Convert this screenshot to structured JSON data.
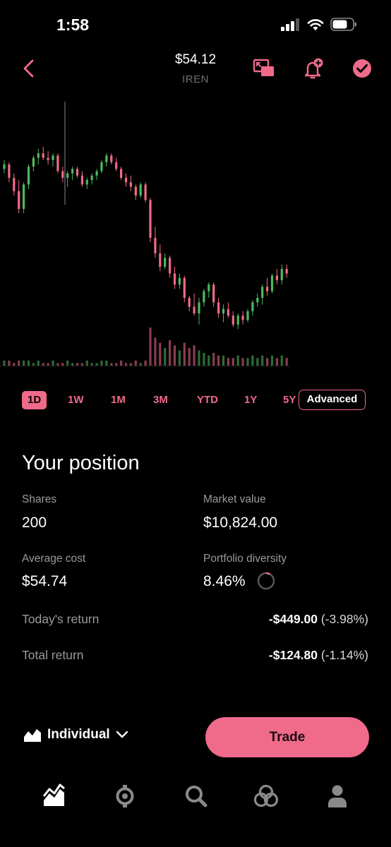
{
  "status_bar": {
    "time": "1:58"
  },
  "header": {
    "price": "$54.12",
    "symbol": "IREN",
    "accent_color": "#f06a8a"
  },
  "chart_data": {
    "type": "candlestick",
    "up_color": "#4cbb5a",
    "down_color": "#f06a8a",
    "ylim": [
      0,
      100
    ],
    "candles": [
      [
        78,
        82,
        76,
        80
      ],
      [
        80,
        81,
        72,
        74
      ],
      [
        74,
        76,
        66,
        68
      ],
      [
        68,
        73,
        58,
        60
      ],
      [
        60,
        72,
        58,
        71
      ],
      [
        71,
        80,
        69,
        79
      ],
      [
        79,
        84,
        77,
        83
      ],
      [
        83,
        87,
        80,
        85
      ],
      [
        85,
        88,
        82,
        83
      ],
      [
        83,
        86,
        80,
        82
      ],
      [
        82,
        85,
        79,
        84
      ],
      [
        84,
        85,
        76,
        77
      ],
      [
        77,
        79,
        72,
        74
      ],
      [
        74,
        77,
        70,
        76
      ],
      [
        76,
        79,
        73,
        78
      ],
      [
        78,
        79,
        74,
        75
      ],
      [
        75,
        77,
        70,
        71
      ],
      [
        71,
        74,
        69,
        73
      ],
      [
        73,
        76,
        71,
        75
      ],
      [
        75,
        78,
        73,
        77
      ],
      [
        77,
        82,
        76,
        81
      ],
      [
        81,
        85,
        79,
        84
      ],
      [
        84,
        85,
        80,
        81
      ],
      [
        81,
        83,
        77,
        78
      ],
      [
        78,
        79,
        73,
        74
      ],
      [
        74,
        76,
        70,
        72
      ],
      [
        72,
        75,
        68,
        70
      ],
      [
        70,
        71,
        64,
        66
      ],
      [
        66,
        72,
        65,
        71
      ],
      [
        71,
        72,
        63,
        64
      ],
      [
        64,
        65,
        45,
        47
      ],
      [
        47,
        52,
        38,
        40
      ],
      [
        40,
        44,
        32,
        34
      ],
      [
        34,
        40,
        33,
        38
      ],
      [
        38,
        39,
        29,
        31
      ],
      [
        31,
        34,
        24,
        26
      ],
      [
        26,
        31,
        24,
        29
      ],
      [
        29,
        30,
        18,
        20
      ],
      [
        20,
        21,
        14,
        16
      ],
      [
        16,
        22,
        12,
        13
      ],
      [
        13,
        20,
        8,
        18
      ],
      [
        18,
        24,
        16,
        23
      ],
      [
        23,
        27,
        20,
        26
      ],
      [
        26,
        27,
        16,
        18
      ],
      [
        18,
        20,
        11,
        13
      ],
      [
        13,
        17,
        9,
        15
      ],
      [
        15,
        18,
        11,
        12
      ],
      [
        12,
        14,
        7,
        8
      ],
      [
        8,
        13,
        6,
        12
      ],
      [
        12,
        14,
        8,
        10
      ],
      [
        10,
        15,
        9,
        14
      ],
      [
        14,
        19,
        12,
        18
      ],
      [
        18,
        22,
        16,
        20
      ],
      [
        20,
        26,
        17,
        25
      ],
      [
        25,
        29,
        21,
        23
      ],
      [
        23,
        31,
        22,
        30
      ],
      [
        30,
        33,
        26,
        28
      ],
      [
        28,
        35,
        26,
        33
      ],
      [
        33,
        35,
        29,
        31
      ]
    ],
    "volumes": [
      2,
      2,
      1,
      2,
      2,
      2,
      1,
      2,
      1,
      1,
      2,
      1,
      1,
      2,
      1,
      1,
      1,
      2,
      1,
      1,
      2,
      2,
      1,
      1,
      2,
      1,
      1,
      2,
      1,
      2,
      15,
      11,
      9,
      7,
      10,
      8,
      6,
      9,
      7,
      8,
      6,
      5,
      4,
      5,
      4,
      4,
      3,
      3,
      4,
      3,
      3,
      4,
      3,
      4,
      3,
      4,
      3,
      4,
      3
    ]
  },
  "ranges": {
    "tabs": [
      "1D",
      "1W",
      "1M",
      "3M",
      "YTD",
      "1Y",
      "5Y"
    ],
    "active": "1D",
    "advanced_label": "Advanced"
  },
  "position": {
    "title": "Your position",
    "shares_label": "Shares",
    "shares_value": "200",
    "market_value_label": "Market value",
    "market_value": "$10,824.00",
    "avg_cost_label": "Average cost",
    "avg_cost_value": "$54.74",
    "diversity_label": "Portfolio diversity",
    "diversity_value": "8.46%",
    "diversity_fraction": 0.0846,
    "todays_return_label": "Today's return",
    "todays_return_amount": "-$449.00",
    "todays_return_pct": "(-3.98%)",
    "total_return_label": "Total return",
    "total_return_amount": "-$124.80",
    "total_return_pct": "(-1.14%)"
  },
  "bottom": {
    "account_label": "Individual",
    "trade_label": "Trade"
  },
  "nav": {
    "items": [
      "chart-icon",
      "browse-icon",
      "search-icon",
      "cards-icon",
      "profile-icon"
    ]
  }
}
